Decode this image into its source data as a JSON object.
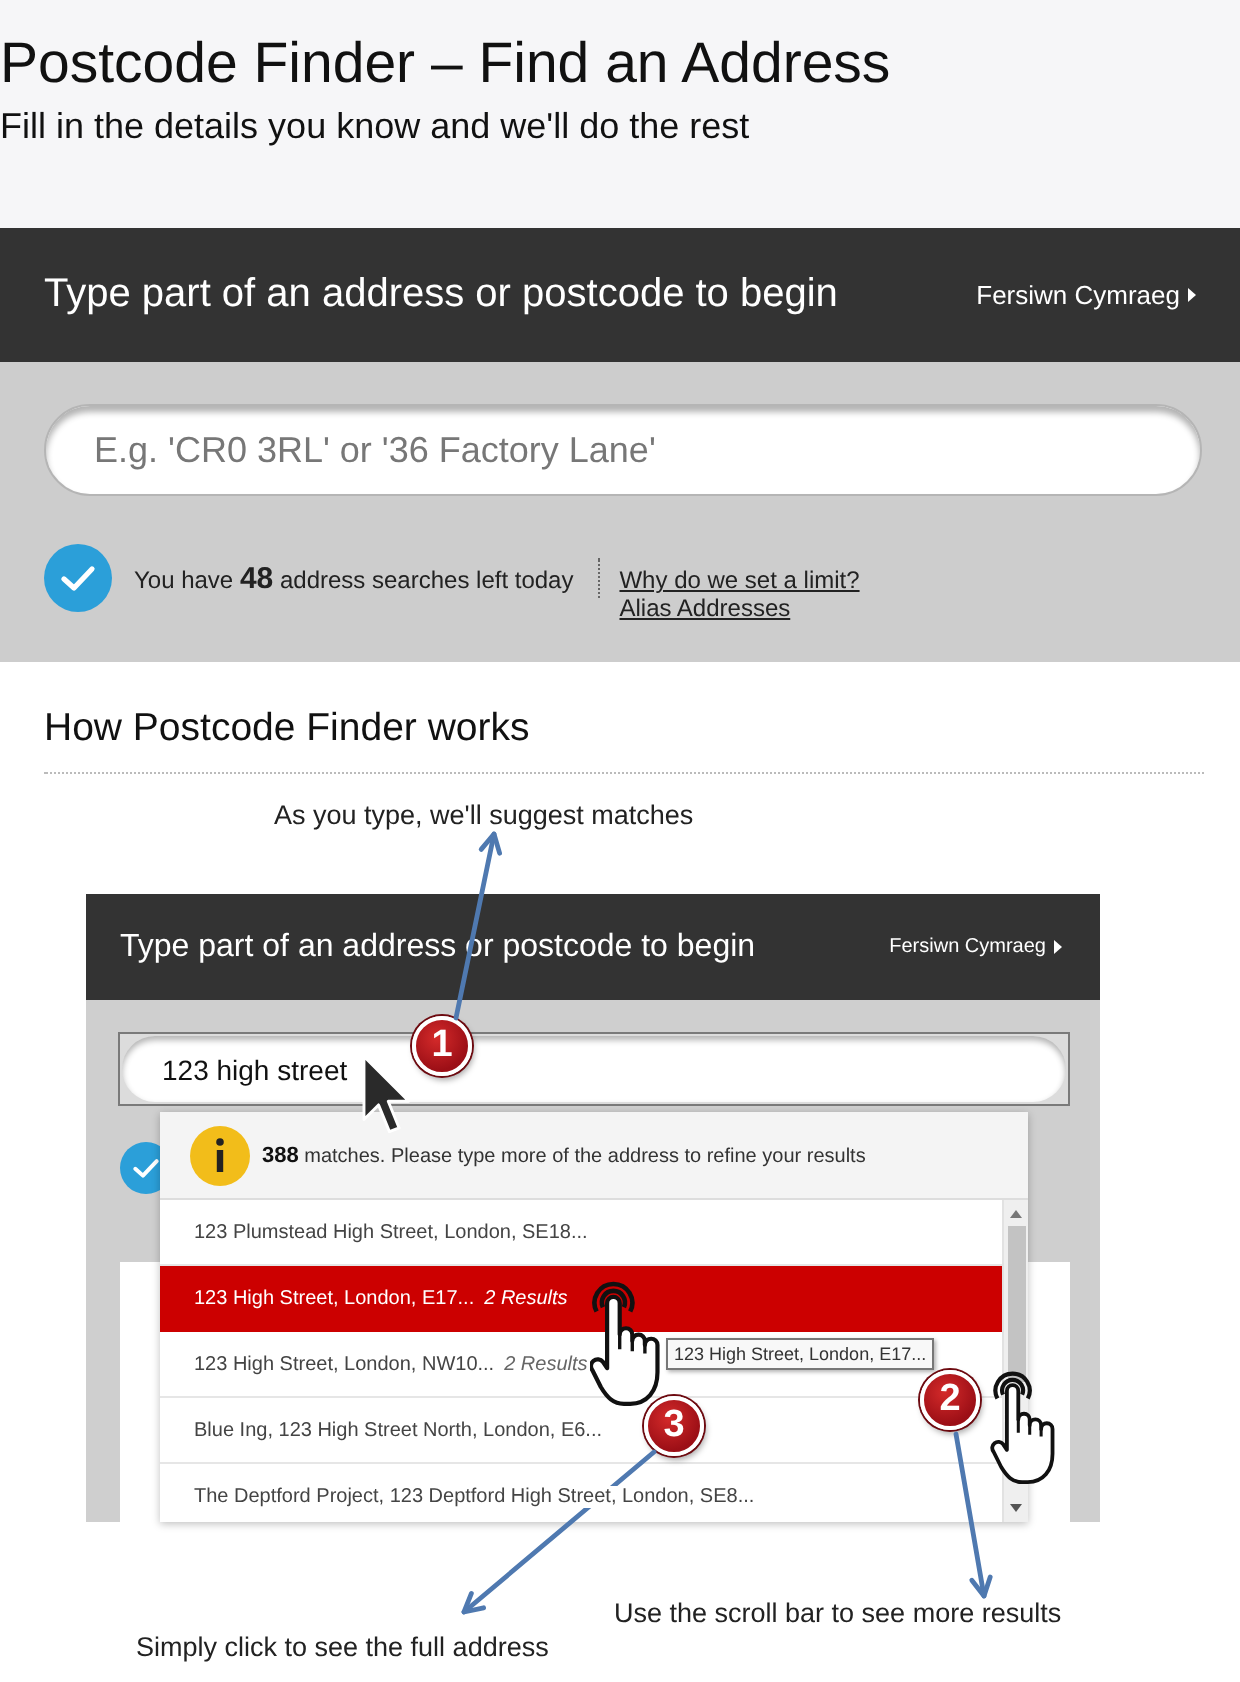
{
  "header": {
    "title": "Postcode Finder – Find an Address",
    "subtitle": "Fill in the details you know and we'll do the rest"
  },
  "search_panel": {
    "prompt": "Type part of an address or postcode to begin",
    "language_link": "Fersiwn Cymraeg",
    "search": {
      "placeholder": "E.g. 'CR0 3RL' or '36 Factory Lane'"
    },
    "limit_notice": "You have **48** address searches left today",
    "links": [
      "Why do we set a limit?",
      "Alias Addresses"
    ]
  },
  "how_it_works": {
    "title": "How Postcode Finder works",
    "example": {
      "prompt": "Type part of an address or postcode to begin",
      "language_link": "Fersiwn Cymraeg",
      "search": {
        "value": "123 high street"
      },
      "match_notice": "**388** matches. Please type more of the address to refine your results",
      "results": [
        {
          "address": "123 Plumstead High Street, London, SE18...",
          "selected": false
        },
        {
          "address": "123 High Street, London, E17...",
          "count": "2 Results",
          "selected": true
        },
        {
          "address": "123 High Street, London, NW10...",
          "count": "2 Results",
          "selected": false
        },
        {
          "address": "Blue Ing, 123 High Street North, London, E6...",
          "selected": false
        },
        {
          "address": "The Deptford Project, 123 Deptford High Street, London, SE8...",
          "selected": false
        }
      ],
      "tooltip": "123 High Street, London, E17..."
    },
    "callouts": [
      {
        "number": "1",
        "caption": "As you type, we'll suggest matches"
      },
      {
        "number": "2",
        "caption": "Use the scroll bar to see more results"
      },
      {
        "number": "3",
        "caption": "Simply click to see the full address"
      }
    ]
  }
}
